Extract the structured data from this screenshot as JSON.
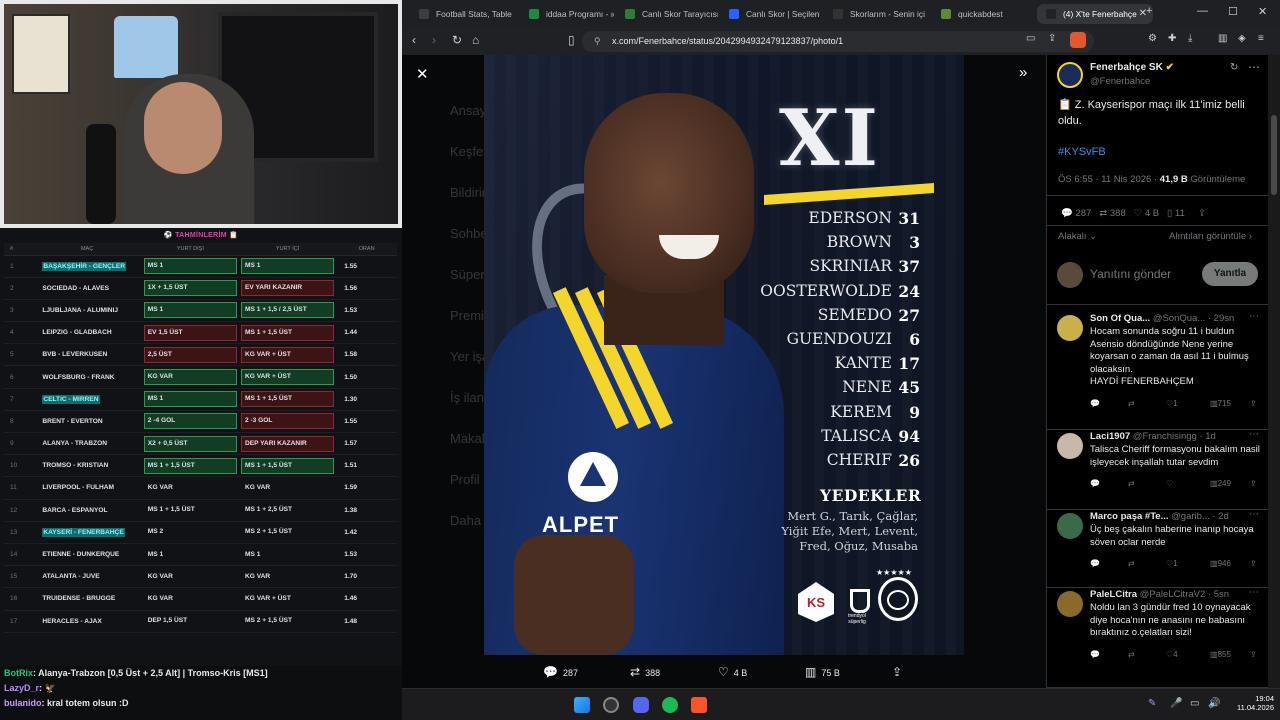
{
  "stream": {
    "tahmin_title": "TAHMİNLERİM",
    "table_headers": [
      "#",
      "MAÇ",
      "YURT DIŞI",
      "YURT İÇİ",
      "ORAN"
    ],
    "rows": [
      {
        "n": "1",
        "match": "BAŞAKŞEHİR - GENÇLER",
        "hl": true,
        "a": "MS 1",
        "ac": "g",
        "b": "MS 1",
        "bc": "g",
        "odd": "1.55"
      },
      {
        "n": "2",
        "match": "SOCIEDAD - ALAVES",
        "hl": false,
        "a": "1X + 1,5 ÜST",
        "ac": "g",
        "b": "EV YARI KAZANIR",
        "bc": "r",
        "odd": "1.56"
      },
      {
        "n": "3",
        "match": "LJUBLJANA - ALUMINIJ",
        "hl": false,
        "a": "MS 1",
        "ac": "g",
        "b": "MS 1 + 1,5 / 2,5 ÜST",
        "bc": "g",
        "odd": "1.53"
      },
      {
        "n": "4",
        "match": "LEIPZIG - GLADBACH",
        "hl": false,
        "a": "EV 1,5 ÜST",
        "ac": "r",
        "b": "MS 1 + 1,5 ÜST",
        "bc": "r",
        "odd": "1.44"
      },
      {
        "n": "5",
        "match": "BVB - LEVERKUSEN",
        "hl": false,
        "a": "2,5 ÜST",
        "ac": "r",
        "b": "KG VAR + ÜST",
        "bc": "r",
        "odd": "1.58"
      },
      {
        "n": "6",
        "match": "WOLFSBURG - FRANK",
        "hl": false,
        "a": "KG VAR",
        "ac": "g",
        "b": "KG VAR + ÜST",
        "bc": "g",
        "odd": "1.50"
      },
      {
        "n": "7",
        "match": "CELTIC - MIRREN",
        "hl": true,
        "a": "MS 1",
        "ac": "g",
        "b": "MS 1 + 1,5 ÜST",
        "bc": "r",
        "odd": "1.30"
      },
      {
        "n": "8",
        "match": "BRENT - EVERTON",
        "hl": false,
        "a": "2 -4 GOL",
        "ac": "g",
        "b": "2 -3 GOL",
        "bc": "r",
        "odd": "1.55"
      },
      {
        "n": "9",
        "match": "ALANYA - TRABZON",
        "hl": false,
        "a": "X2 + 0,5 ÜST",
        "ac": "g",
        "b": "DEP YARI KAZANIR",
        "bc": "r",
        "odd": "1.57"
      },
      {
        "n": "10",
        "match": "TROMSO - KRISTIAN",
        "hl": false,
        "a": "MS 1 + 1,5 ÜST",
        "ac": "g",
        "b": "MS 1 + 1,5 ÜST",
        "bc": "g",
        "odd": "1.51"
      },
      {
        "n": "11",
        "match": "LIVERPOOL - FULHAM",
        "hl": false,
        "a": "KG VAR",
        "ac": "",
        "b": "KG VAR",
        "bc": "",
        "odd": "1.59"
      },
      {
        "n": "12",
        "match": "BARCA - ESPANYOL",
        "hl": false,
        "a": "MS 1 + 1,5 ÜST",
        "ac": "",
        "b": "MS 1 + 2,5 ÜST",
        "bc": "",
        "odd": "1.38"
      },
      {
        "n": "13",
        "match": "KAYSERİ - FENERBAHÇE",
        "hl": true,
        "a": "MS 2",
        "ac": "",
        "b": "MS 2 + 1,5 ÜST",
        "bc": "",
        "odd": "1.42"
      },
      {
        "n": "14",
        "match": "ETIENNE - DUNKERQUE",
        "hl": false,
        "a": "MS 1",
        "ac": "",
        "b": "MS 1",
        "bc": "",
        "odd": "1.53"
      },
      {
        "n": "15",
        "match": "ATALANTA - JUVE",
        "hl": false,
        "a": "KG VAR",
        "ac": "",
        "b": "KG VAR",
        "bc": "",
        "odd": "1.70"
      },
      {
        "n": "16",
        "match": "TRUIDENSE - BRUGGE",
        "hl": false,
        "a": "KG VAR",
        "ac": "",
        "b": "KG VAR + ÜST",
        "bc": "",
        "odd": "1.46"
      },
      {
        "n": "17",
        "match": "HERACLES - AJAX",
        "hl": false,
        "a": "DEP 1,5 ÜST",
        "ac": "",
        "b": "MS 2 + 1,5 ÜST",
        "bc": "",
        "odd": "1.48"
      }
    ],
    "chat": [
      {
        "user": "BotRix",
        "text": ": Alanya-Trabzon [0,5 Üst + 2,5 Alt] | Tromso-Kris [MS1]",
        "color": "#26c281"
      },
      {
        "user": "LazyD_r",
        "text": ": 🦅",
        "color": "#b48cff"
      },
      {
        "user": "bulanido",
        "text": ": kral totem olsun :D",
        "color": "#c89bff"
      }
    ]
  },
  "browser": {
    "tabs": [
      "Football Stats, Table",
      "iddaa Programı - ıdd",
      "Canlı Skor Tarayıcısı",
      "Canlı Skor | Seçilen n",
      "Skorlarım - Senin içi",
      "quickabdest",
      "(4) X'te Fenerbahçe"
    ],
    "url": "x.com/Fenerbahce/status/2042994932479123837/photo/1"
  },
  "poster": {
    "title": "XI",
    "lineup": [
      {
        "name": "EDERSON",
        "num": "31"
      },
      {
        "name": "BROWN",
        "num": "3"
      },
      {
        "name": "SKRINIAR",
        "num": "37"
      },
      {
        "name": "OOSTERWOLDE",
        "num": "24"
      },
      {
        "name": "SEMEDO",
        "num": "27"
      },
      {
        "name": "GUENDOUZI",
        "num": "6"
      },
      {
        "name": "KANTE",
        "num": "17"
      },
      {
        "name": "NENE",
        "num": "45"
      },
      {
        "name": "KEREM",
        "num": "9"
      },
      {
        "name": "TALISCA",
        "num": "94"
      },
      {
        "name": "CHERIF",
        "num": "26"
      }
    ],
    "subs_title": "YEDEKLER",
    "subs": [
      "Mert G., Tarık, Çağlar,",
      "Yiğit Efe, Mert, Levent,",
      "Fred, Oğuz, Musaba"
    ],
    "sponsor": "ALPET",
    "ks": "KS",
    "league": "trendyol süperlig"
  },
  "dimmed_menu": [
    "Ansayfa",
    "Keşfet",
    "Bildirimler",
    "Sohbet",
    "Süper",
    "Premium",
    "Yer işaretleri",
    "İş ilanları",
    "Makale",
    "Profil",
    "Daha fazla"
  ],
  "viewer_actions": {
    "reply": "287",
    "retweet": "388",
    "like": "4 B",
    "views": "75 B"
  },
  "tweet": {
    "author": "Fenerbahçe SK",
    "handle": "@Fenerbahce",
    "text": "📋 Z. Kayserispor maçı ilk 11'imiz belli oldu.",
    "hashtag": "#KYSvFB",
    "time": "ÖS 6:55 · 11 Nis 2026 · ",
    "views_count": "41,9 B",
    "views_label": " Görüntüleme",
    "stats": {
      "reply": "287",
      "retweet": "388",
      "like": "4 B",
      "bookmark": "11"
    },
    "sort": "Alakalı",
    "quotes": "Alıntıları görüntüle",
    "reply_placeholder": "Yanıtını gönder",
    "reply_button": "Yanıtla"
  },
  "replies": [
    {
      "name": "Son Of Qua...",
      "handle": "@SonQua... · 29sn",
      "text": "Hocam sonunda soğru 11 i buldun Asensio döndüğünde Nene yerine koyarsan o zaman da asıl 11 i bulmuş olacaksın.\nHAYDİ FENERBAHÇEM",
      "like": "1",
      "views": "715",
      "av": "#c8b04a"
    },
    {
      "name": "Laci1907",
      "handle": "@Franchisingg · 1d",
      "text": "Talisca Cheriff formasyonu bakalım nasil işleyecek inşallah tutar sevdim",
      "like": "",
      "views": "249",
      "av": "#c9b7a8"
    },
    {
      "name": "Marco paşa #Te...",
      "handle": "@garib... · 2d",
      "text": "Üç beş çakalın haberine inanıp hocaya söven oclar nerde",
      "like": "1",
      "views": "946",
      "av": "#3a6a4a"
    },
    {
      "name": "PaleLCitra",
      "handle": "@PaleLCitraV2 · 5sn",
      "text": "Noldu lan 3 gündür fred 10 oynayacak diye hoca'nın ne anasını ne babasını bıraktınız o.çelatları sizi!",
      "like": "4",
      "views": "855",
      "av": "#8a6a2a"
    }
  ],
  "taskbar": {
    "time": "19:04",
    "date": "11.04.2026"
  }
}
